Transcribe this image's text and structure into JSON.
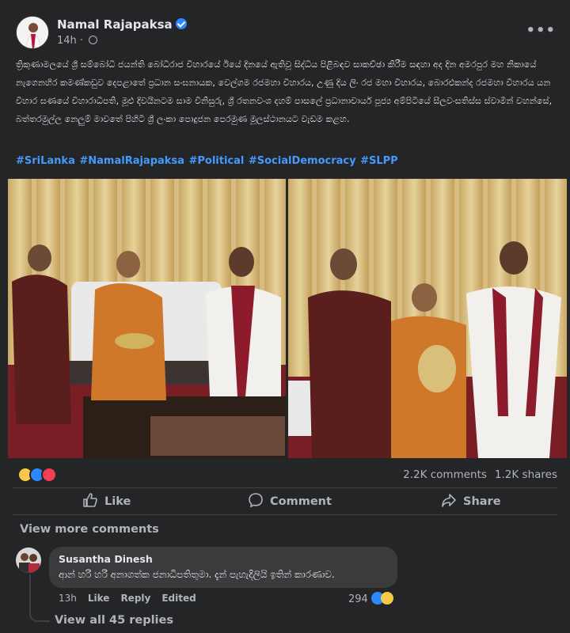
{
  "post": {
    "author": "Namal Rajapaksa",
    "time": "14h",
    "caption": "ත්‍රිකුණාමලයේ ශ්‍රී සම්බෝධි ජයන්ති බෝධිරාජ විහාරයේ ඊයේ දිනයේ ඇතිවූ සිද්ධිය පිළිබඳව සාකච්ඡා කිරීම සඳහා අද දින අමරපුර මහ නිකායේ නැගෙනහිර කමණ්කඩුව දෙපළාතේ ප්‍රධාන සංඝනායක, වෙල්ගම රජමහා විහාරය, උණු දිය ලිං රජ මහා විහාරය, බොරළුකන්ද රජමහා විහාරය යන විහාර ඝණයේ විහාරාධිපති, මූළු දිවයිනටම සාම විනිසුරු, ශ්‍රී රතනවංශ දහම් පාසලේ ප්‍රධානාචාර්ය පූජ්‍ය අම්පිටියේ සීලවංසතිස්ස ස්වාමින් වහන්සේ, බත්තරමුල්ල නෙලුම් මාවතේ පිහිටි ශ්‍රී ලංකා පොදුජන පෙරමුණ මූලස්ථානයට වැඩම කළහ.",
    "hashtags": "#SriLanka #NamalRajapaksa #Political #SocialDemocracy #SLPP"
  },
  "stats": {
    "comments": "2.2K comments",
    "shares": "1.2K shares"
  },
  "actions": {
    "like": "Like",
    "comment": "Comment",
    "share": "Share"
  },
  "comments_section": {
    "view_more": "View more comments",
    "comment": {
      "author": "Susantha Dinesh",
      "text": "ආන් හරි හරි අනාගත්ක ජනාධිපතිතුමා. දැන් පැහැදිලියි ඉතින් කාරණාව.",
      "time": "13h",
      "like": "Like",
      "reply": "Reply",
      "edited": "Edited",
      "reaction_count": "294"
    },
    "view_replies": "View all 45 replies"
  },
  "icons": {
    "verified": "verified-badge-icon",
    "globe": "globe-icon",
    "more": "more-options-icon",
    "like": "thumbs-up-icon",
    "comment": "comment-bubble-icon",
    "share": "share-arrow-icon"
  },
  "colors": {
    "background": "#242526",
    "link": "#4599ff",
    "verified": "#2d88ff"
  }
}
